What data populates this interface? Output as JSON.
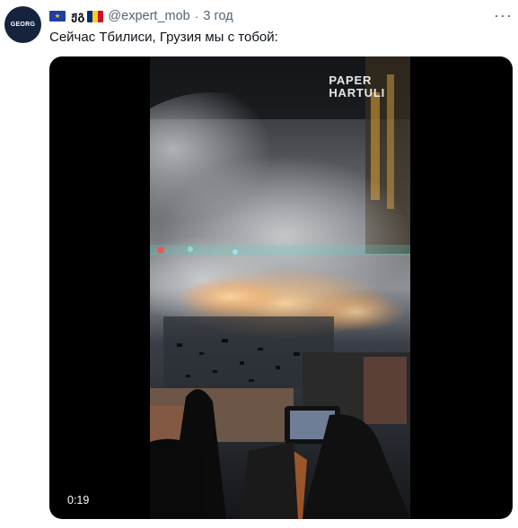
{
  "tweet": {
    "avatar_text": "GEORG",
    "author_name": "ჟგ",
    "handle": "@expert_mob",
    "separator": "·",
    "time": "3 год",
    "text": "Сейчас Тбилиси, Грузия мы с тобой:",
    "more_icon": "more-dots-icon",
    "flag_left": "eu-flag-icon",
    "flag_right": "romania-flag-icon"
  },
  "media": {
    "watermark_line1": "PAPER",
    "watermark_line2": "HARTULI",
    "duration": "0:19"
  },
  "colors": {
    "muted_text": "#536471",
    "text": "#0f1419",
    "avatar_bg": "#16233d"
  }
}
